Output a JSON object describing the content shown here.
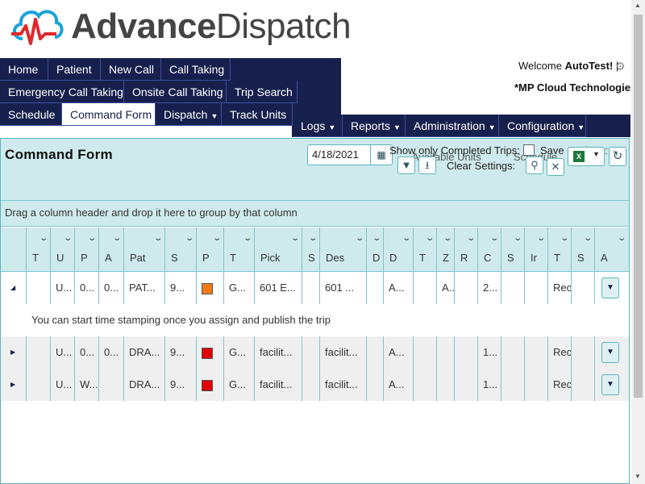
{
  "brand": {
    "name_bold": "Advance",
    "name_light": "Dispatch",
    "colors": {
      "navy": "#17204c",
      "teal": "#59b5bd",
      "light_teal": "#cfeaec",
      "logo_red": "#e0272b",
      "logo_blue": "#1aa3d9"
    }
  },
  "nav": {
    "row1": [
      "Home",
      "Patient",
      "New Call",
      "Call Taking"
    ],
    "row2": [
      "Emergency Call Taking",
      "Onsite Call Taking",
      "Trip Search"
    ],
    "row3": [
      "Schedule",
      "Command Form",
      "Dispatch",
      "Track Units"
    ],
    "row4": [
      "Logs",
      "Reports",
      "Administration",
      "Configuration"
    ],
    "active": "Command Form"
  },
  "user": {
    "welcome_prefix": "Welcome",
    "username": "AutoTest!",
    "separator": "|",
    "company": "*MP Cloud Technologies"
  },
  "form": {
    "title": "Command Form",
    "date_value": "4/18/2021",
    "show_completed_label": "Show only Completed Trips:",
    "save_settings_label": "Save Settings:",
    "clear_settings_label": "Clear Settings:",
    "available_units_label": "Available Units",
    "schedule_label": "Schedule"
  },
  "group_bar": {
    "text": "Drag a column header and drop it here to group by that column"
  },
  "grid": {
    "headers": [
      "T",
      "U",
      "P",
      "A",
      "Pat",
      "S",
      "P",
      "T",
      "Pick",
      "S",
      "Des",
      "D",
      "D",
      "T",
      "Z",
      "R",
      "C",
      "S",
      "Ir",
      "T",
      "S",
      "A"
    ],
    "rows": [
      {
        "expanded": true,
        "cells": [
          "",
          "U...",
          "0...",
          "0...",
          "PAT...",
          "9...",
          "",
          "G...",
          "601 E...",
          "",
          "601 ...",
          "",
          "A...",
          "",
          "A...",
          "",
          "2...",
          "",
          "",
          "Rec",
          "",
          ""
        ],
        "swatch": "#f07a1a",
        "detail": "You can start time stamping once you assign and publish the trip"
      },
      {
        "expanded": false,
        "cells": [
          "",
          "U...",
          "0...",
          "0...",
          "DRA...",
          "9...",
          "",
          "G...",
          "facilit...",
          "",
          "facilit...",
          "",
          "A...",
          "",
          "",
          "",
          "1...",
          "",
          "",
          "Rec",
          "",
          ""
        ],
        "swatch": "#e00000"
      },
      {
        "expanded": false,
        "cells": [
          "",
          "U...",
          "W...",
          "",
          "DRA...",
          "9...",
          "",
          "G...",
          "facilit...",
          "",
          "facilit...",
          "",
          "A...",
          "",
          "",
          "",
          "1...",
          "",
          "",
          "Rec",
          "",
          ""
        ],
        "swatch": "#e00000"
      }
    ]
  },
  "icons": {
    "gear": "gear-icon",
    "calendar": "calendar-icon",
    "filter": "filter-icon",
    "download": "download-icon",
    "pin": "pin-icon",
    "clear": "clear-icon",
    "excel": "excel-icon",
    "refresh": "refresh-icon"
  }
}
